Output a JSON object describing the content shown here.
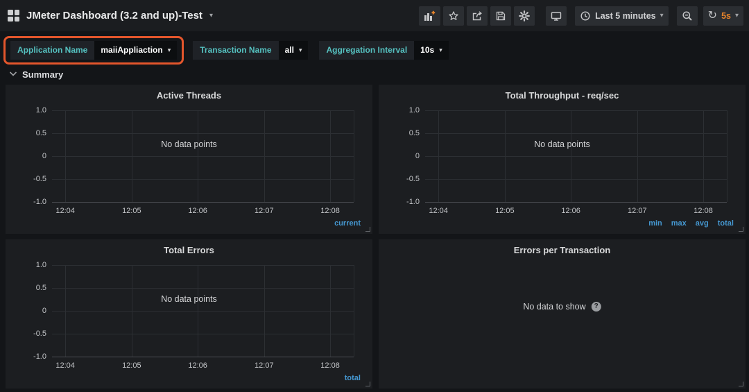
{
  "navbar": {
    "title": "JMeter Dashboard (3.2 and up)-Test",
    "time_range_label": "Last 5 minutes",
    "refresh_interval": "5s",
    "icons": [
      "dashboard-grid",
      "bar-chart-add",
      "star",
      "share",
      "save",
      "gear",
      "monitor",
      "clock",
      "magnifier-zoom-out",
      "refresh",
      "caret-down"
    ]
  },
  "variables": [
    {
      "label": "Application Name",
      "value": "maiiAppliaction",
      "highlighted": true
    },
    {
      "label": "Transaction Name",
      "value": "all",
      "highlighted": false
    },
    {
      "label": "Aggregation Interval",
      "value": "10s",
      "highlighted": false
    }
  ],
  "row": {
    "title": "Summary"
  },
  "colors": {
    "highlight_box": "#e4562c",
    "refresh_interval_text": "#e8842a",
    "variable_label": "#55c1c0",
    "legend_text": "#4597d0",
    "panel_background": "#1c1e21",
    "page_background": "#131518"
  },
  "panels": [
    {
      "title": "Active Threads",
      "chart_data": {
        "type": "line",
        "title": "Active Threads",
        "x_ticks": [
          "12:04",
          "12:05",
          "12:06",
          "12:07",
          "12:08"
        ],
        "y_ticks": [
          "1.0",
          "0.5",
          "0",
          "-0.5",
          "-1.0"
        ],
        "ylim": [
          -1.0,
          1.0
        ],
        "grid": true,
        "series": [],
        "no_data": "No data points",
        "legend_items": [
          "current"
        ],
        "legend_position": "bottom-right"
      }
    },
    {
      "title": "Total Throughput - req/sec",
      "chart_data": {
        "type": "line",
        "title": "Total Throughput - req/sec",
        "x_ticks": [
          "12:04",
          "12:05",
          "12:06",
          "12:07",
          "12:08"
        ],
        "y_ticks": [
          "1.0",
          "0.5",
          "0",
          "-0.5",
          "-1.0"
        ],
        "ylim": [
          -1.0,
          1.0
        ],
        "grid": true,
        "series": [],
        "no_data": "No data points",
        "legend_items": [
          "min",
          "max",
          "avg",
          "total"
        ],
        "legend_position": "bottom-right"
      }
    },
    {
      "title": "Total Errors",
      "chart_data": {
        "type": "line",
        "title": "Total Errors",
        "x_ticks": [
          "12:04",
          "12:05",
          "12:06",
          "12:07",
          "12:08"
        ],
        "y_ticks": [
          "1.0",
          "0.5",
          "0",
          "-0.5",
          "-1.0"
        ],
        "ylim": [
          -1.0,
          1.0
        ],
        "grid": true,
        "series": [],
        "no_data": "No data points",
        "legend_items": [
          "total"
        ],
        "legend_position": "bottom-right"
      }
    },
    {
      "title": "Errors per Transaction",
      "chart_data": {
        "type": "pie",
        "title": "Errors per Transaction",
        "series": [],
        "no_data": "No data to show"
      }
    }
  ]
}
